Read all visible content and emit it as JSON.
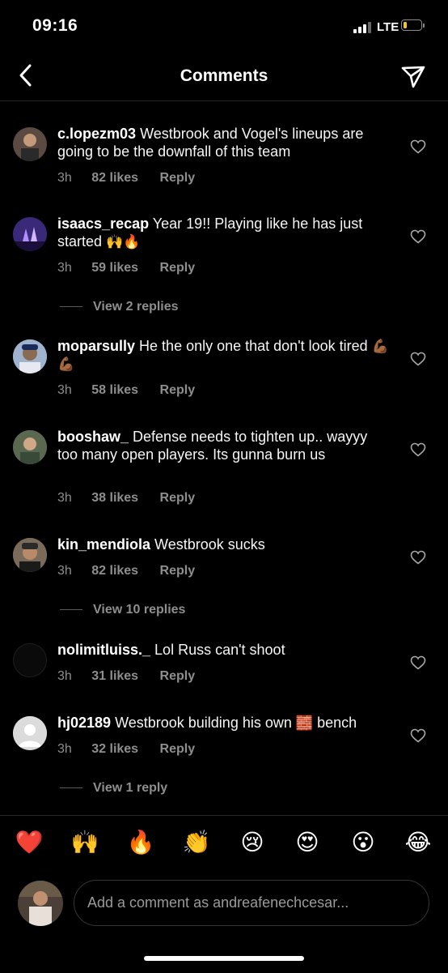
{
  "status_bar": {
    "time": "09:16",
    "network": "LTE",
    "battery_percent": 20
  },
  "header": {
    "title": "Comments",
    "back_icon": "chevron-left-icon",
    "send_icon": "paper-plane-icon"
  },
  "comments": [
    {
      "username": "c.lopezm03",
      "text": "Westbrook and Vogel's lineups are going to be the downfall of this team",
      "time": "3h",
      "likes": "82 likes",
      "reply": "Reply",
      "avatar_color": "#5a4a42"
    },
    {
      "username": "isaacs_recap",
      "text": "Year 19!! Playing like he has just started",
      "emoji": "🙌🔥",
      "time": "3h",
      "likes": "59 likes",
      "reply": "Reply",
      "view_replies": "View 2 replies",
      "avatar_color": "#4a2a8a"
    },
    {
      "username": "moparsully",
      "text": "He the only one that don't look tired",
      "emoji": "💪🏾💪🏾",
      "time": "3h",
      "likes": "58 likes",
      "reply": "Reply",
      "avatar_color": "#7a8aa0"
    },
    {
      "username": "booshaw_",
      "text": "Defense needs to tighten up.. wayyy too many open players. Its gunna burn us",
      "time": "3h",
      "likes": "38 likes",
      "reply": "Reply",
      "avatar_color": "#6a7a60"
    },
    {
      "username": "kin_mendiola",
      "text": "Westbrook sucks",
      "time": "3h",
      "likes": "82 likes",
      "reply": "Reply",
      "view_replies": "View 10 replies",
      "avatar_color": "#8a7a6a"
    },
    {
      "username": "nolimitluiss._",
      "text": "Lol Russ can't shoot",
      "time": "3h",
      "likes": "31 likes",
      "reply": "Reply",
      "avatar_color": "#0a0a0a"
    },
    {
      "username": "hj02189",
      "text": "Westbrook building his own",
      "emoji": "🧱",
      "text_after": "bench",
      "time": "3h",
      "likes": "32 likes",
      "reply": "Reply",
      "view_replies": "View 1 reply",
      "avatar_color": "#dbdbdb"
    }
  ],
  "emoji_bar": [
    "❤️",
    "🙌",
    "🔥",
    "👏",
    "😢",
    "😍",
    "😮",
    "😂"
  ],
  "composer": {
    "placeholder": "Add a comment as andreafenechcesar..."
  }
}
